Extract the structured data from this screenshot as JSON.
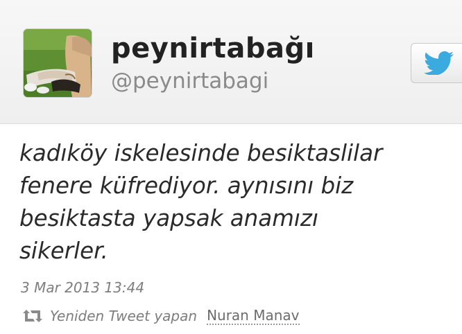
{
  "profile": {
    "display_name": "peynirtabağı",
    "handle": "@peynirtabagi",
    "avatar_icon": "profile-photo"
  },
  "follow_button": {
    "icon": "twitter-bird-icon",
    "brand_color": "#3aaadf"
  },
  "tweet": {
    "text": "kadıköy iskelesinde besiktaslilar\nfenere küfrediyor. aynısını biz\nbesiktasta yapsak anamızı\nsikerler.",
    "timestamp": "3 Mar 2013 13:44"
  },
  "retweet": {
    "icon": "retweet-icon",
    "label": "Yeniden Tweet yapan",
    "user": "Nuran Manav"
  }
}
